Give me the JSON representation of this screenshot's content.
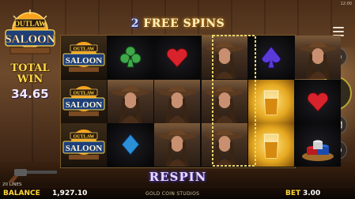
{
  "status": {
    "clock": "12:00"
  },
  "logo": {
    "line1": "OUTLAW",
    "line2": "SALOON"
  },
  "total_win": {
    "label_line1": "TOTAL",
    "label_line2": "WIN",
    "value": "34.65"
  },
  "free_spins": {
    "count": "2",
    "label": "FREE SPINS"
  },
  "reels": [
    [
      "logo-wild",
      "logo-wild",
      "logo-wild"
    ],
    [
      "club",
      "cowgirl",
      "diamond"
    ],
    [
      "heart",
      "cowgirl",
      "cowgirl"
    ],
    [
      "cowgirl",
      "cowgirl",
      "cowgirl"
    ],
    [
      "spade",
      "whiskey",
      "whiskey"
    ],
    [
      "cowgirl",
      "heart",
      "poker-chips"
    ]
  ],
  "respin_label": "RESPIN",
  "footer": {
    "lines": "20 LINES",
    "balance_label": "BALANCE",
    "balance_value": "1,927.10",
    "studio": "GOLD COIN STUDIOS",
    "bet_label": "BET",
    "bet_value": "3.00"
  },
  "colors": {
    "gold": "#ffd63a",
    "spin_button": "#e8cc1d",
    "highlight_border": "#e8d46a"
  }
}
